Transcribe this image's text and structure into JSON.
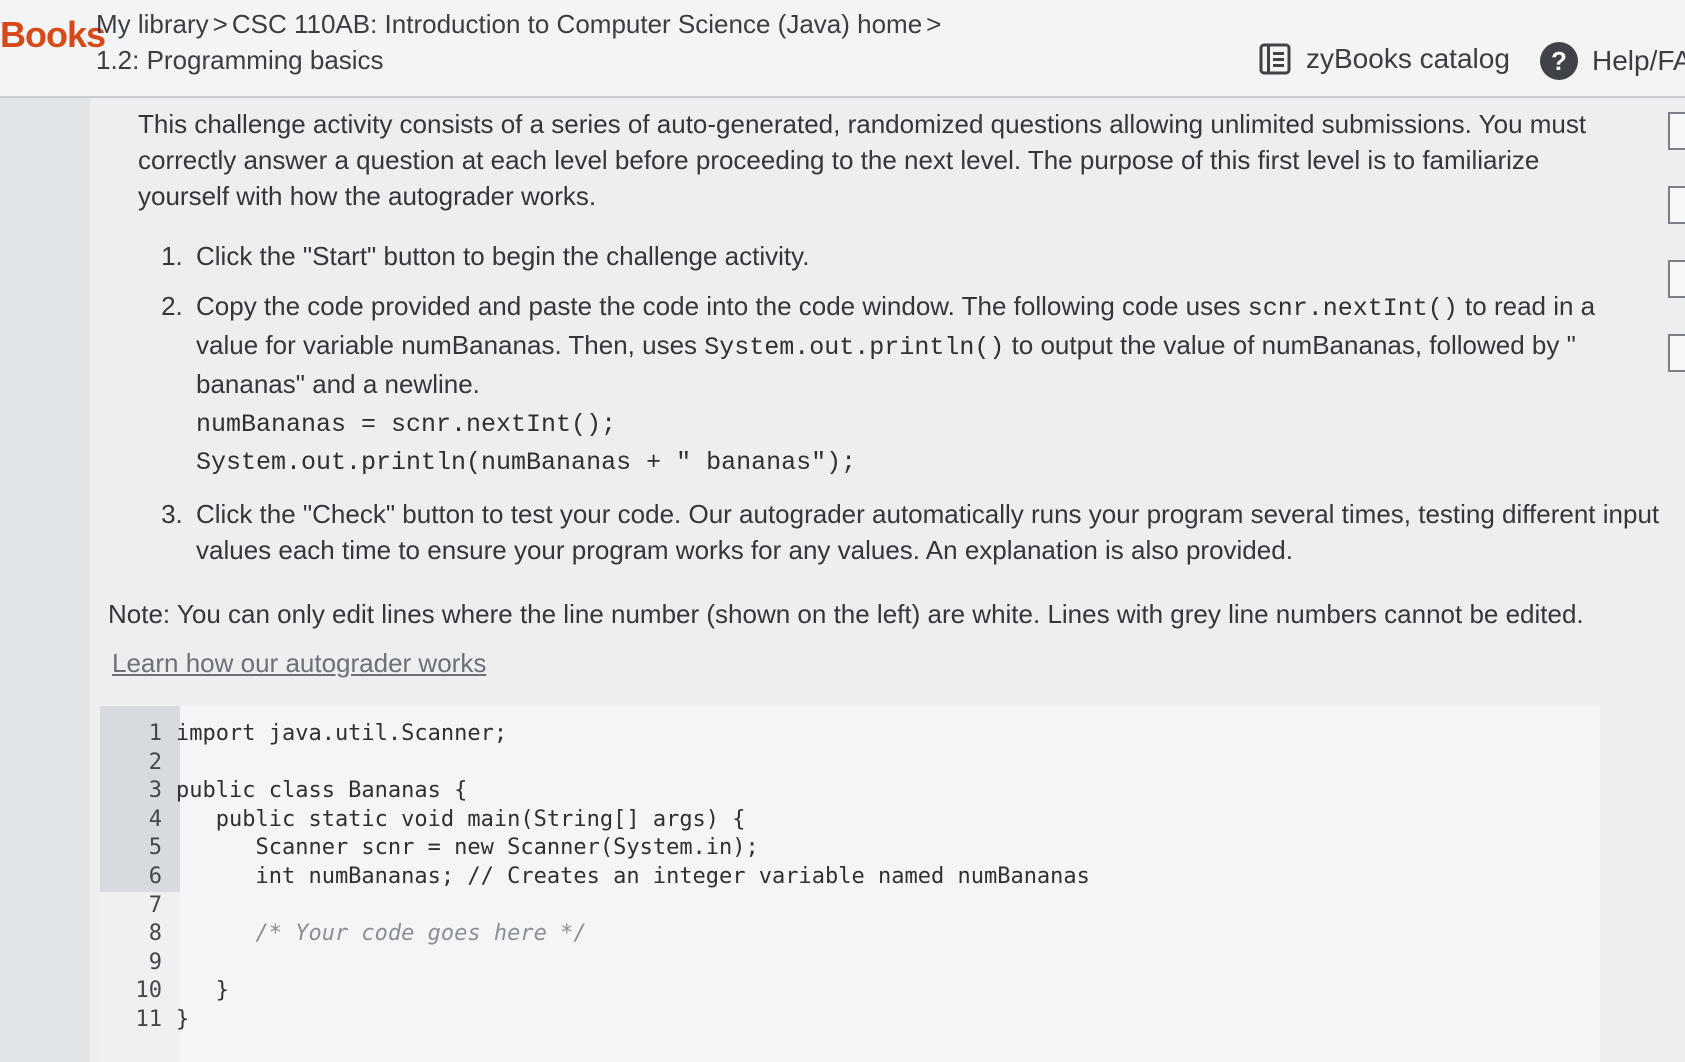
{
  "header": {
    "logo_text": "Books",
    "breadcrumb": {
      "library": "My library",
      "sep1": ">",
      "course": "CSC 110AB: Introduction to Computer Science (Java) home",
      "sep2": ">",
      "section": "1.2: Programming basics"
    },
    "catalog_label": "zyBooks catalog",
    "help_label": "Help/FA"
  },
  "intro": "This challenge activity consists of a series of auto-generated, randomized questions allowing unlimited submissions. You must correctly answer a question at each level before proceeding to the next level. The purpose of this first level is to familiarize yourself with how the autograder works.",
  "steps": {
    "s1": "Click the \"Start\" button to begin the challenge activity.",
    "s2_a": "Copy the code provided and paste the code into the code window. The following code uses ",
    "s2_code1": "scnr.nextInt()",
    "s2_b": " to read in a value for variable numBananas. Then, uses ",
    "s2_code2": "System.out.println()",
    "s2_c": " to output the value of numBananas, followed by \" bananas\" and a newline.",
    "s2_line1": "numBananas = scnr.nextInt();",
    "s2_line2": "System.out.println(numBananas + \" bananas\");",
    "s3": "Click the \"Check\" button to test your code. Our autograder automatically runs your program several times, testing different input values each time to ensure your program works for any values. An explanation is also provided."
  },
  "note": "Note: You can only edit lines where the line number (shown on the left) are white. Lines with grey line numbers cannot be edited.",
  "learn_link": "Learn how our autograder works",
  "editor": {
    "lines": [
      {
        "n": "1",
        "code": "import java.util.Scanner;"
      },
      {
        "n": "2",
        "code": ""
      },
      {
        "n": "3",
        "code": "public class Bananas {"
      },
      {
        "n": "4",
        "code": "   public static void main(String[] args) {"
      },
      {
        "n": "5",
        "code": "      Scanner scnr = new Scanner(System.in);"
      },
      {
        "n": "6",
        "code": "      int numBananas; // Creates an integer variable named numBananas"
      },
      {
        "n": "7",
        "code": ""
      },
      {
        "n": "8",
        "code": "      /* Your code goes here */"
      },
      {
        "n": "9",
        "code": ""
      },
      {
        "n": "10",
        "code": "   }"
      },
      {
        "n": "11",
        "code": "}"
      }
    ]
  },
  "icons": {
    "catalog": "book-icon",
    "help": "question-circle-icon"
  },
  "colors": {
    "logo": "#d64a1a",
    "gutter_readonly": "#d7dbe0"
  }
}
